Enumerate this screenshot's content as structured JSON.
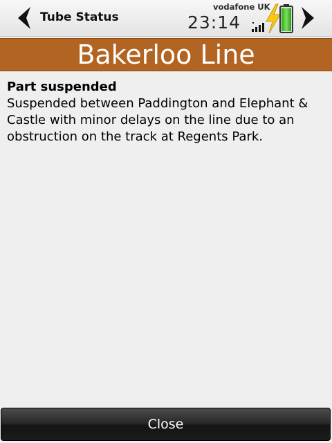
{
  "status_bar": {
    "app_title": "Tube Status",
    "carrier": "vodafone UK",
    "clock": "23:14",
    "icons": {
      "back": "chevron-left-icon",
      "forward": "chevron-right-icon",
      "signal": "signal-strength-icon",
      "charging": "charging-bolt-icon",
      "battery": "battery-icon"
    }
  },
  "line": {
    "name": "Bakerloo Line",
    "color": "#b26422"
  },
  "status": {
    "heading": "Part suspended",
    "detail": "Suspended between Paddington and Elephant & Castle with minor delays on the line due to an obstruction on the track at Regents Park."
  },
  "footer": {
    "close_label": "Close"
  }
}
